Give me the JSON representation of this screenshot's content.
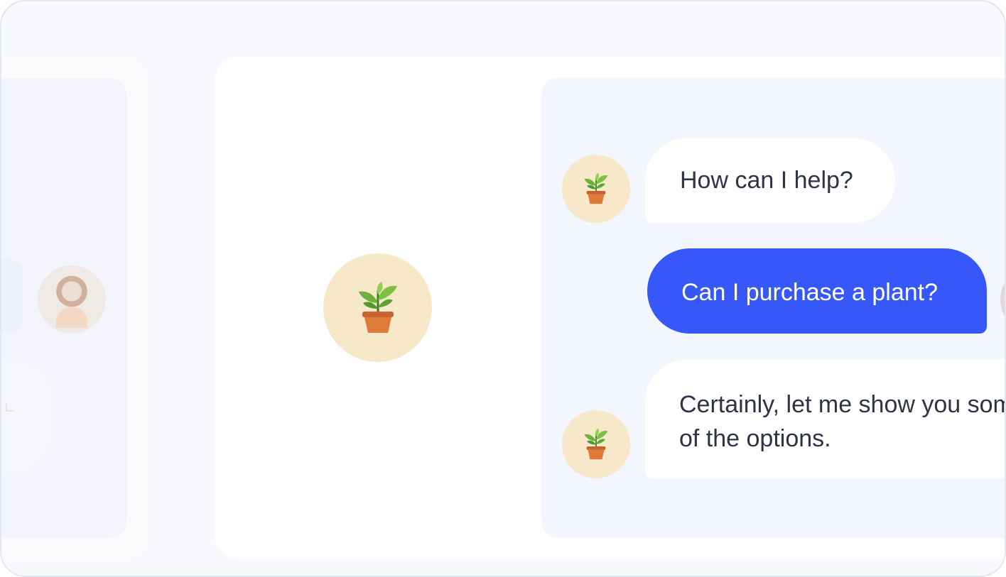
{
  "chat": {
    "messages": [
      {
        "sender": "bot",
        "text": "How can I help?"
      },
      {
        "sender": "user",
        "text": "Can I purchase a plant?"
      },
      {
        "sender": "bot",
        "text": "Certainly, let me show you some of the options."
      }
    ]
  },
  "icons": {
    "bot_avatar": "potted-plant-icon",
    "user_avatar": "person-photo"
  },
  "colors": {
    "accent": "#3758f9",
    "avatar_bg": "#f7e8c9",
    "chat_panel_bg": "#f3f6fe",
    "bot_bubble_bg": "#ffffff",
    "text_dark": "#2e3446"
  }
}
